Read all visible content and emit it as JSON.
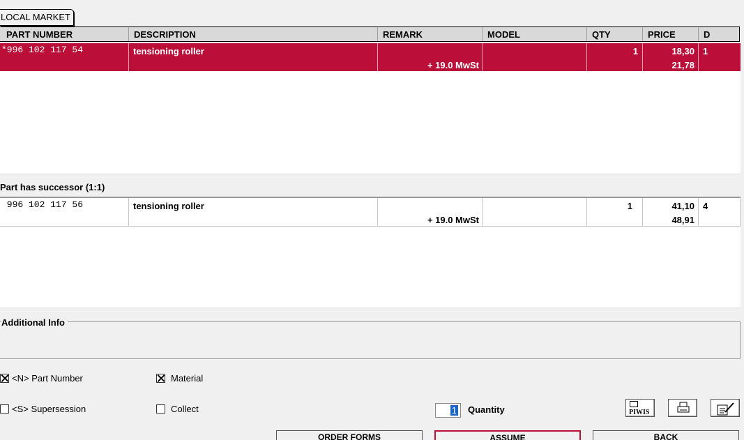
{
  "tab_label": "LOCAL MARKET",
  "columns": [
    "PART NUMBER",
    "DESCRIPTION",
    "REMARK",
    "MODEL",
    "QTY",
    "PRICE",
    "D"
  ],
  "main_row": {
    "part_number": "*996 102 117 54",
    "description": "tensioning roller",
    "remark_line2": "+ 19.0 MwSt",
    "model": "",
    "qty": "1",
    "price_net": "18,30",
    "price_gross": "21,78",
    "d": "1"
  },
  "successor_label": "Part has successor (1:1)",
  "successor_row": {
    "part_number": " 996 102 117 56",
    "description": "tensioning roller",
    "remark_line2": "+ 19.0 MwSt",
    "model": "",
    "qty": "1",
    "price_net": "41,10",
    "price_gross": "48,91",
    "d": "4"
  },
  "additional_info_label": "Additional Info",
  "options": {
    "part_number": {
      "label_prefix": "<N>",
      "label": " Part Number",
      "checked": true
    },
    "material": {
      "label": "Material",
      "checked": true
    },
    "supersession": {
      "label_prefix": "<S>",
      "label": " Supersession",
      "checked": false
    },
    "collect": {
      "label": "Collect",
      "checked": false
    }
  },
  "quantity": {
    "value": "1",
    "label": "Quantity"
  },
  "icons": {
    "piwis": "PIWIS",
    "print": "printer-icon",
    "edit": "edit-icon"
  },
  "buttons": {
    "order_forms": "ORDER FORMS",
    "assume": "ASSUME",
    "back": "BACK"
  },
  "colors": {
    "selection": "#bb0f3a",
    "assume_border": "#bb0f3a"
  }
}
